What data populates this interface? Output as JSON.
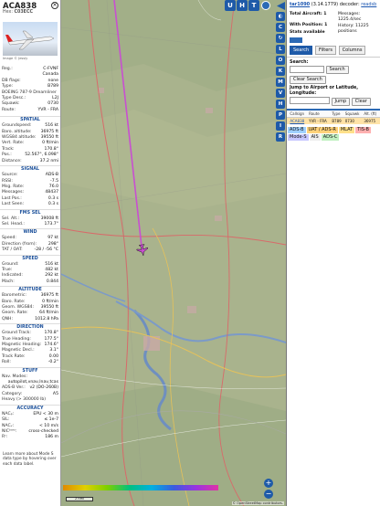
{
  "aircraft": {
    "callsign": "ACA838",
    "hex_label": "Hex:",
    "hex": "C03ECC",
    "image_credit": "Image © Jessly",
    "details": [
      {
        "label": "Reg.:",
        "value": "C-FVNF"
      },
      {
        "label": "",
        "value": "Canada"
      },
      {
        "label": "DB flags:",
        "value": "none"
      },
      {
        "label": "Type:",
        "value": "B789"
      },
      {
        "label": "BOEING 787-9 Dreamliner",
        "value": ""
      },
      {
        "label": "Type Desc.:",
        "value": "L2J"
      },
      {
        "label": "Squawk:",
        "value": "0730"
      },
      {
        "label": "Route:",
        "value": "YVR - FRA"
      }
    ]
  },
  "sections": [
    {
      "title": "SPATIAL",
      "rows": [
        {
          "label": "Groundspeed:",
          "value": "516 kt"
        },
        {
          "label": "Baro. altitude:",
          "value": "36975 ft"
        },
        {
          "label": "WGS84 altitude:",
          "value": "39550 ft"
        },
        {
          "label": "Vert. Rate:",
          "value": "0 ft/min"
        },
        {
          "label": "Track:",
          "value": "170.8°"
        },
        {
          "label": "Pos.:",
          "value": "52.567°, 6.098°"
        },
        {
          "label": "Distance:",
          "value": "37.2 nmi"
        }
      ]
    },
    {
      "title": "SIGNAL",
      "rows": [
        {
          "label": "Source:",
          "value": "ADS-B"
        },
        {
          "label": "RSSI:",
          "value": "-7.5"
        },
        {
          "label": "Msg. Rate:",
          "value": "76.0"
        },
        {
          "label": "Messages:",
          "value": "48437"
        },
        {
          "label": "Last Pos.:",
          "value": "0.3 s"
        },
        {
          "label": "Last Seen:",
          "value": "0.3 s"
        }
      ]
    },
    {
      "title": "FMS SEL",
      "rows": [
        {
          "label": "Sel. Alt.:",
          "value": "39008 ft"
        },
        {
          "label": "Sel. Head.:",
          "value": "173.7°"
        }
      ]
    },
    {
      "title": "WIND",
      "rows": [
        {
          "label": "Speed:",
          "value": "97 kt"
        },
        {
          "label": "Direction (from):",
          "value": "298°"
        },
        {
          "label": "TAT / OAT:",
          "value": "-28 / -56 °C"
        }
      ]
    },
    {
      "title": "SPEED",
      "rows": [
        {
          "label": "Ground:",
          "value": "516 kt"
        },
        {
          "label": "True:",
          "value": "482 kt"
        },
        {
          "label": "Indicated:",
          "value": "292 kt"
        },
        {
          "label": "Mach:",
          "value": "0.844"
        }
      ]
    },
    {
      "title": "ALTITUDE",
      "rows": [
        {
          "label": "Barometric:",
          "value": "36975 ft"
        },
        {
          "label": "Baro. Rate:",
          "value": "0 ft/min"
        },
        {
          "label": "Geom. WGS84:",
          "value": "39550 ft"
        },
        {
          "label": "Geom. Rate:",
          "value": "64 ft/min"
        },
        {
          "label": "QNH:",
          "value": "1012.8 hPa"
        }
      ]
    },
    {
      "title": "DIRECTION",
      "rows": [
        {
          "label": "Ground Track:",
          "value": "170.8°"
        },
        {
          "label": "True Heading:",
          "value": "177.5°"
        },
        {
          "label": "Magnetic Heading:",
          "value": "174.6°"
        },
        {
          "label": "Magnetic Decl.:",
          "value": "3.1°"
        },
        {
          "label": "Track Rate:",
          "value": "0.00"
        },
        {
          "label": "Roll:",
          "value": "-0.2°"
        }
      ]
    },
    {
      "title": "STUFF",
      "rows": [
        {
          "label": "Nav. Modes:",
          "value": ""
        },
        {
          "label": "",
          "value": "autopilot,vnav,lnav,tcas"
        },
        {
          "label": "ADS-B Ver.:",
          "value": "v2 (DO-260B)"
        },
        {
          "label": "Category:",
          "value": "A5"
        },
        {
          "label": "Heavy (> 300000 lb)",
          "value": ""
        }
      ]
    },
    {
      "title": "ACCURACY",
      "rows": [
        {
          "label": "NACₚ:",
          "value": "EPU < 30 m"
        },
        {
          "label": "SIL:",
          "value": "≤ 1e-7"
        },
        {
          "label": "NACᵥ:",
          "value": "< 10 m/s"
        },
        {
          "label": "NICᵇᵃʳᵒ:",
          "value": "cross-checked"
        },
        {
          "label": "Rᶜ:",
          "value": "186 m"
        }
      ]
    }
  ],
  "footer_note": "Learn more about Mode S data type by hovering over each data label.",
  "map_buttons": {
    "u": "U",
    "h": "H",
    "t": "T"
  },
  "side_buttons": [
    "◐",
    "C",
    "↻",
    "L",
    "O",
    "K",
    "M",
    "V",
    "H",
    "P",
    "I",
    "R"
  ],
  "attribution": "© OpenStreetMap contributors.",
  "scale": "2 nmi",
  "zoom_in": "+",
  "zoom_out": "−",
  "right": {
    "link": "tar1090",
    "version": "(3.14.1779)",
    "decoder_label": "decoder:",
    "decoder": "readsb",
    "total_aircraft": "Total Aircraft: 1",
    "messages_label": "Messages:",
    "messages_rate": "1225.4/sec",
    "with_position": "With Position: 1",
    "history_label": "History: 11225",
    "history_unit": "positions",
    "stats": "Stats available",
    "tabs": [
      "Search",
      "Filters",
      "Columns"
    ],
    "search_label": "Search:",
    "search_button": "Search",
    "clear_search": "Clear Search",
    "jump_label": "Jump to Airport or Latitude, Longitude:",
    "jump_button": "Jump",
    "clear_button": "Clear",
    "table_headers": [
      "",
      "Callsign",
      "Route",
      "Type",
      "Squawk",
      "Alt. (ft)"
    ],
    "table_row": [
      "",
      "ACA838",
      "YVR - FRA",
      "B789",
      "0730",
      "36975"
    ],
    "sources": [
      {
        "label": "ADS-B",
        "color": "#9fd0ff"
      },
      {
        "label": "UAT / ADS-R",
        "color": "#ffd27a"
      },
      {
        "label": "MLAT",
        "color": "#ffe08a"
      },
      {
        "label": "TIS-B",
        "color": "#ffb0b0"
      },
      {
        "label": "Mode-S",
        "color": "#c8c8ff"
      },
      {
        "label": "AIS",
        "color": "#eeeeee"
      },
      {
        "label": "ADS-C",
        "color": "#c0f0c0"
      }
    ]
  }
}
